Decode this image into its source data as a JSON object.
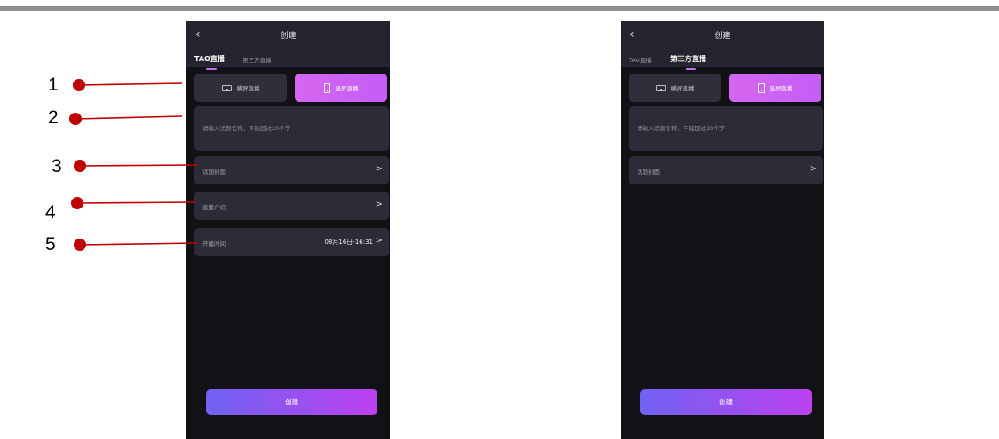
{
  "screens": [
    {
      "nav": {
        "back": "‹",
        "title": "创建"
      },
      "tabs": [
        {
          "label": "TAO直播",
          "active": true
        },
        {
          "label": "第三方直播",
          "active": false
        }
      ],
      "orientation": {
        "landscape": "横屏直播",
        "portrait": "竖屏直播",
        "selected": "portrait"
      },
      "topic_placeholder": "请输入话题名称，不能超过20个字",
      "rows": [
        {
          "label": "话题封面",
          "value": ""
        },
        {
          "label": "直播介绍",
          "value": ""
        },
        {
          "label": "开播时间",
          "value": "08月16日-16:31"
        }
      ],
      "create_label": "创建"
    },
    {
      "nav": {
        "back": "‹",
        "title": "创建"
      },
      "tabs": [
        {
          "label": "TAO直播",
          "active": false
        },
        {
          "label": "第三方直播",
          "active": true
        }
      ],
      "orientation": {
        "landscape": "横屏直播",
        "portrait": "竖屏直播",
        "selected": "portrait"
      },
      "topic_placeholder": "请输入话题名称，不能超过20个字",
      "rows": [
        {
          "label": "话题封面",
          "value": ""
        }
      ],
      "create_label": "创建"
    }
  ],
  "annotations": [
    "1",
    "2",
    "3",
    "4",
    "5"
  ],
  "colors": {
    "background": "#111116",
    "panel": "#2b2c38",
    "header": "#23242f",
    "accent": "#c35ef5",
    "annotation_dot": "#c00000"
  },
  "icons": [
    "back-chevron-icon",
    "landscape-screen-icon",
    "portrait-screen-icon",
    "chevron-right-icon"
  ]
}
